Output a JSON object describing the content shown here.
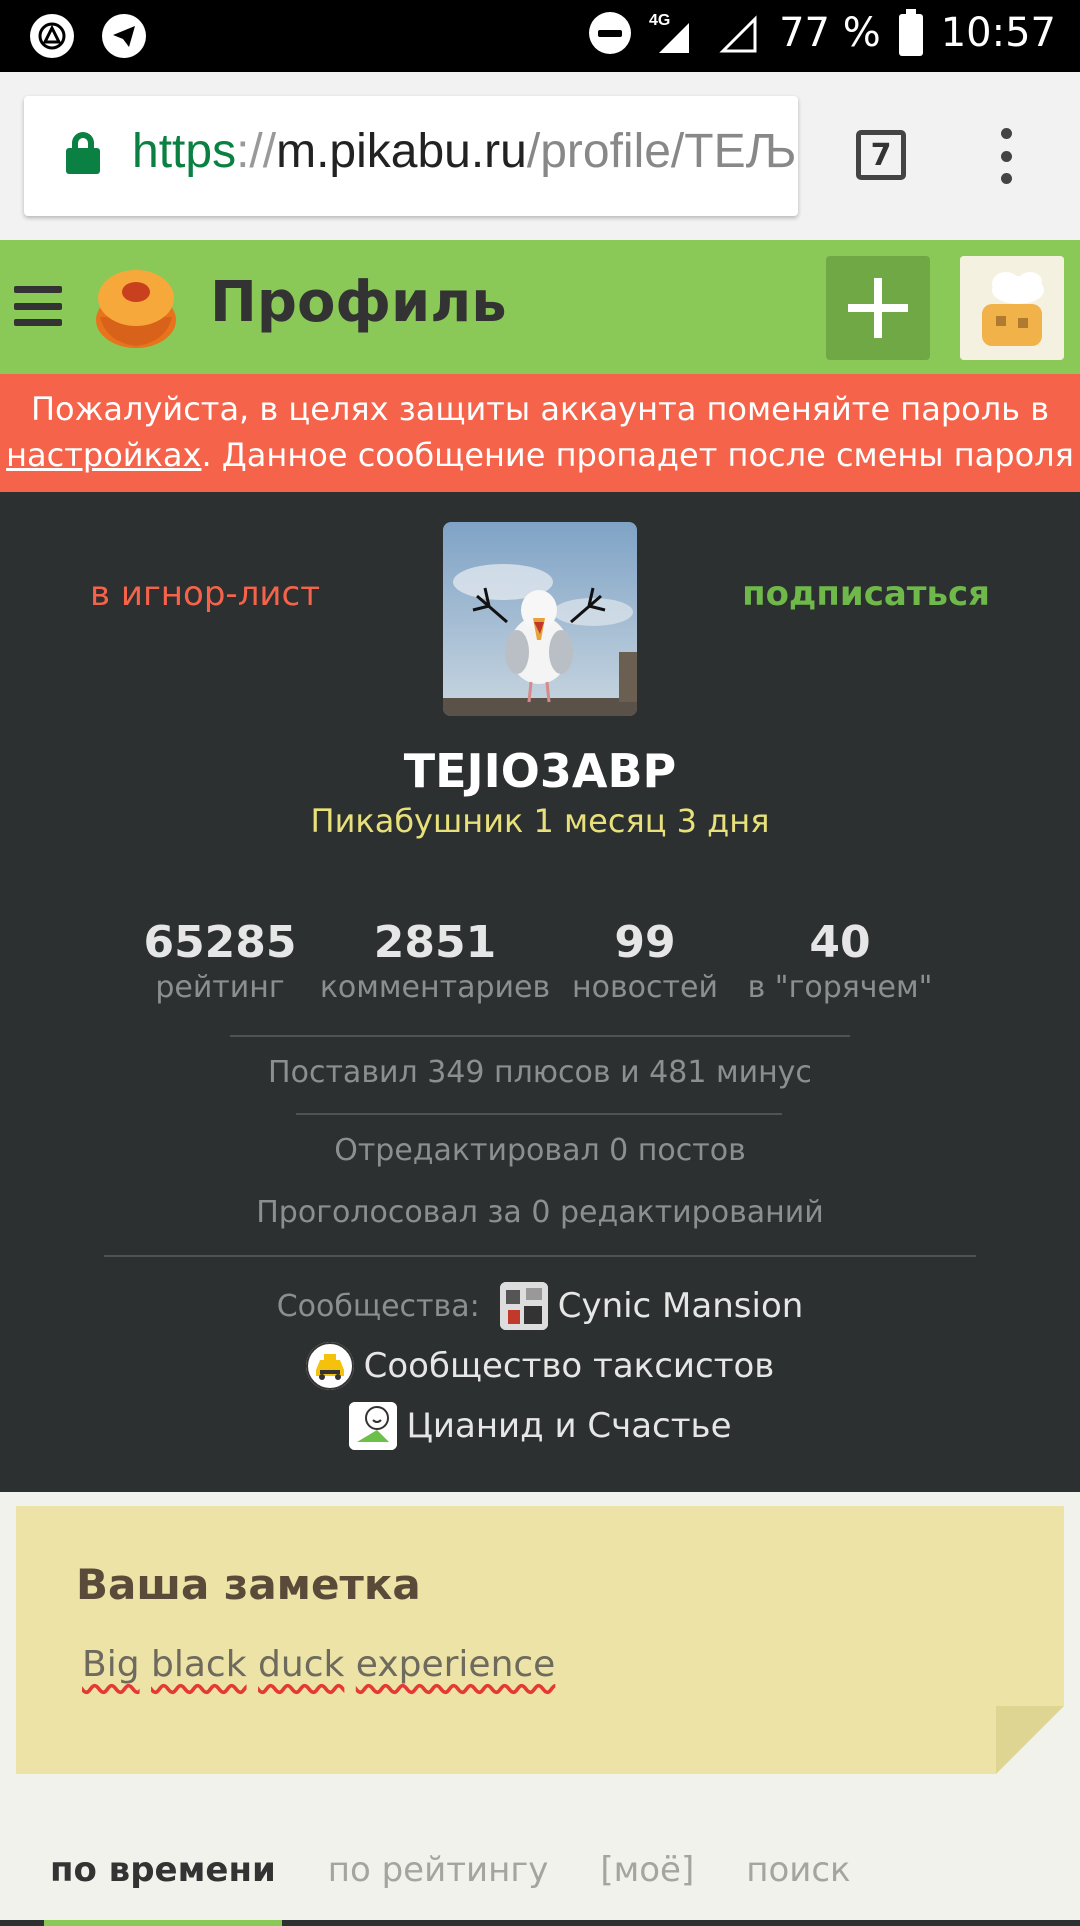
{
  "status_bar": {
    "battery": "77 %",
    "time": "10:57",
    "network": "4G"
  },
  "browser": {
    "url_scheme": "https",
    "url_sep": "://",
    "url_host": "m.pikabu.ru",
    "url_path": "/profile/TEЉ",
    "tab_count": "7"
  },
  "header": {
    "title": "Профиль"
  },
  "warning": {
    "text_before": "Пожалуйста, в целях защиты аккаунта поменяйте пароль в ",
    "link": "настройках",
    "text_after": ". Данное сообщение пропадет после смены пароля"
  },
  "profile": {
    "ignore_label": "в игнор-лист",
    "subscribe_label": "подписаться",
    "username": "TEJIO3ABP",
    "tenure": "Пикабушник 1 месяц 3 дня"
  },
  "stats": [
    {
      "value": "65285",
      "label": "рейтинг"
    },
    {
      "value": "2851",
      "label": "комментариев"
    },
    {
      "value": "99",
      "label": "новостей"
    },
    {
      "value": "40",
      "label": "в \"горячем\""
    }
  ],
  "votes_line": "Поставил 349 плюсов и 481 минус",
  "edited_line": "Отредактировал 0 постов",
  "voted_edits_line": "Проголосовал за 0 редактирований",
  "communities": {
    "label": "Сообщества:",
    "items": [
      "Cynic Mansion",
      "Сообщество таксистов",
      "Цианид и Счастье"
    ]
  },
  "note": {
    "title": "Ваша заметка",
    "text_words": [
      "Big",
      "black",
      "duck",
      "experience"
    ]
  },
  "tabs": [
    "по времени",
    "по рейтингу",
    "[моё]",
    "поиск"
  ],
  "colors": {
    "header_green": "#8ac858",
    "warning_red": "#f5634a",
    "dark_bg": "#2d3030",
    "note_yellow": "#ede3a6",
    "tenure_yellow": "#e8e07a",
    "subscribe_green": "#6fb84a"
  }
}
